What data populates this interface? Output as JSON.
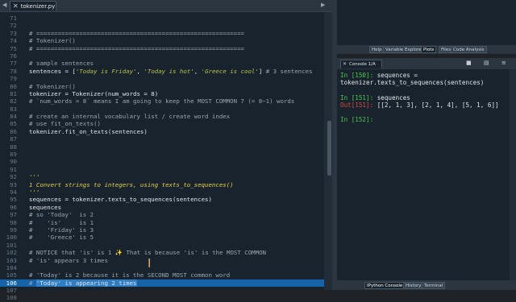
{
  "editor": {
    "tab": {
      "filename": "tokenizer.py",
      "close": "✕"
    },
    "lines": [
      {
        "n": "71",
        "text": ""
      },
      {
        "n": "72",
        "text": ""
      },
      {
        "n": "73",
        "text": "# ==========================================================",
        "cls": "c-comment"
      },
      {
        "n": "74",
        "text": "# Tokenizer()",
        "cls": "c-comment"
      },
      {
        "n": "75",
        "text": "# ==========================================================",
        "cls": "c-comment"
      },
      {
        "n": "76",
        "text": ""
      },
      {
        "n": "77",
        "text": "# sample sentences",
        "cls": "c-comment"
      },
      {
        "n": "78",
        "parts": [
          {
            "t": "sentences = ["
          },
          {
            "t": "'Today is Friday'",
            "cls": "c-str"
          },
          {
            "t": ", "
          },
          {
            "t": "'Today is hot'",
            "cls": "c-str"
          },
          {
            "t": ", "
          },
          {
            "t": "'Greece is cool'",
            "cls": "c-str"
          },
          {
            "t": "] "
          },
          {
            "t": "# 3 sentences",
            "cls": "c-comment"
          }
        ]
      },
      {
        "n": "79",
        "text": ""
      },
      {
        "n": "80",
        "text": "# Tokenizer()",
        "cls": "c-comment"
      },
      {
        "n": "81",
        "text": "tokenizer = Tokenizer(num_words = 8)"
      },
      {
        "n": "82",
        "text": "# `num_words = 8` means I am going to keep the MOST COMMON 7 (= 8−1) words",
        "cls": "c-comment"
      },
      {
        "n": "83",
        "text": ""
      },
      {
        "n": "84",
        "text": "# create an internal vocabulary list / create word index",
        "cls": "c-comment"
      },
      {
        "n": "85",
        "text": "# use fit_on_texts()",
        "cls": "c-comment"
      },
      {
        "n": "86",
        "text": "tokenizer.fit_on_texts(sentences)"
      },
      {
        "n": "87",
        "text": ""
      },
      {
        "n": "88",
        "text": ""
      },
      {
        "n": "89",
        "text": ""
      },
      {
        "n": "90",
        "text": ""
      },
      {
        "n": "91",
        "text": ""
      },
      {
        "n": "92",
        "text": "'''",
        "cls": "c-doc"
      },
      {
        "n": "93",
        "text": "1 Convert strings to integers, using texts_to_sequences()",
        "cls": "c-doc"
      },
      {
        "n": "94",
        "text": "'''",
        "cls": "c-doc"
      },
      {
        "n": "95",
        "text": "sequences = tokenizer.texts_to_sequences(sentences)"
      },
      {
        "n": "96",
        "text": "sequences"
      },
      {
        "n": "97",
        "text": "# so 'Today'  is 2",
        "cls": "c-comment"
      },
      {
        "n": "98",
        "text": "#    'is'     is 1",
        "cls": "c-comment"
      },
      {
        "n": "99",
        "text": "#    'Friday' is 3",
        "cls": "c-comment"
      },
      {
        "n": "100",
        "text": "#    'Greece' is 5",
        "cls": "c-comment"
      },
      {
        "n": "101",
        "text": ""
      },
      {
        "n": "102",
        "text": "# NOTICE that 'is' is 1 ✨ That is because 'is' is the MOST COMMON",
        "cls": "c-comment"
      },
      {
        "n": "103",
        "text": "# 'is' appears 3 times",
        "cls": "c-comment"
      },
      {
        "n": "104",
        "text": ""
      },
      {
        "n": "105",
        "text": "# 'Today' is 2 because it is the SECOND MOST common word",
        "cls": "c-comment"
      },
      {
        "n": "106",
        "prefix": "# ",
        "highlight": "'Today' is appearing 2 times",
        "active": true,
        "cls": "c-comment"
      },
      {
        "n": "107",
        "text": ""
      },
      {
        "n": "108",
        "text": ""
      }
    ]
  },
  "top_pane_tabs": [
    "Help",
    "Variable Explorer",
    "Plots",
    "Files",
    "Code Analysis"
  ],
  "top_pane_active": "Plots",
  "console": {
    "tab_label": "Console 1/A",
    "lines": [
      {
        "prompt": "In [150]: ",
        "kind": "in",
        "text": "sequences ="
      },
      {
        "prompt": "",
        "kind": "plain",
        "text": "tokenizer.texts_to_sequences(sentences)"
      },
      {
        "blank": true
      },
      {
        "prompt": "In [151]: ",
        "kind": "in",
        "text": "sequences"
      },
      {
        "prompt": "Out[151]: ",
        "kind": "out",
        "text": "[[2, 1, 3], [2, 1, 4], [5, 1, 6]]"
      },
      {
        "blank": true
      },
      {
        "prompt": "In [152]: ",
        "kind": "in",
        "text": ""
      }
    ]
  },
  "bottom_tabs": [
    "IPython Console",
    "History",
    "Terminal"
  ],
  "bottom_active": "IPython Console",
  "colors": {
    "editor_bg": "#19232d",
    "active_line": "#1563a8",
    "in_prompt": "#4cc94c",
    "out_prompt": "#e0443c"
  }
}
